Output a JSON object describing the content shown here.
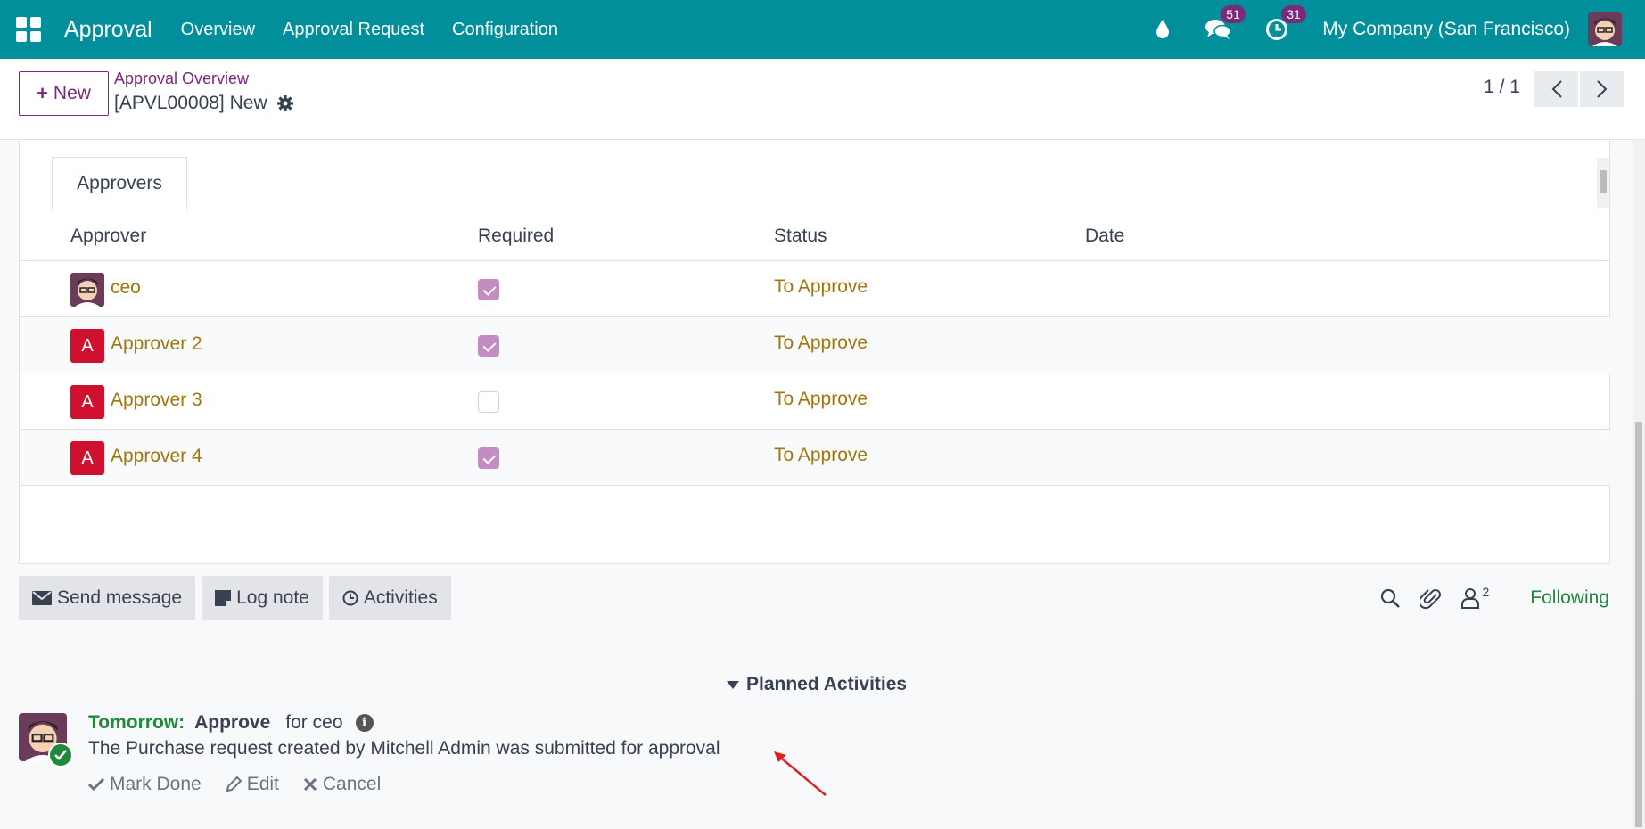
{
  "navbar": {
    "brand": "Approval",
    "menu": [
      "Overview",
      "Approval Request",
      "Configuration"
    ],
    "messages_count": "51",
    "activities_count": "31",
    "company": "My Company (San Francisco)"
  },
  "control": {
    "new_label": "New",
    "breadcrumb": "Approval Overview",
    "record_title": "[APVL00008] New",
    "pager": "1 / 1"
  },
  "tabs": {
    "approvers": "Approvers"
  },
  "table": {
    "headers": {
      "approver": "Approver",
      "required": "Required",
      "status": "Status",
      "date": "Date"
    },
    "rows": [
      {
        "name": "ceo",
        "initial": "",
        "required": true,
        "status": "To Approve",
        "date": ""
      },
      {
        "name": "Approver 2",
        "initial": "A",
        "required": true,
        "status": "To Approve",
        "date": ""
      },
      {
        "name": "Approver 3",
        "initial": "A",
        "required": false,
        "status": "To Approve",
        "date": ""
      },
      {
        "name": "Approver 4",
        "initial": "A",
        "required": true,
        "status": "To Approve",
        "date": ""
      }
    ]
  },
  "chatter": {
    "send_message": "Send message",
    "log_note": "Log note",
    "activities": "Activities",
    "followers_count": "2",
    "following": "Following",
    "planned_label": "Planned Activities"
  },
  "activity": {
    "when": "Tomorrow:",
    "type": "Approve",
    "for": "for ceo",
    "note": "The Purchase request created by Mitchell Admin was submitted for approval",
    "mark_done": "Mark Done",
    "edit": "Edit",
    "cancel": "Cancel"
  },
  "colors": {
    "navbar": "#008f9b",
    "accent": "#7a2a7a",
    "status": "#a0770d",
    "following": "#1f8a3b",
    "arrow": "#e02020"
  }
}
